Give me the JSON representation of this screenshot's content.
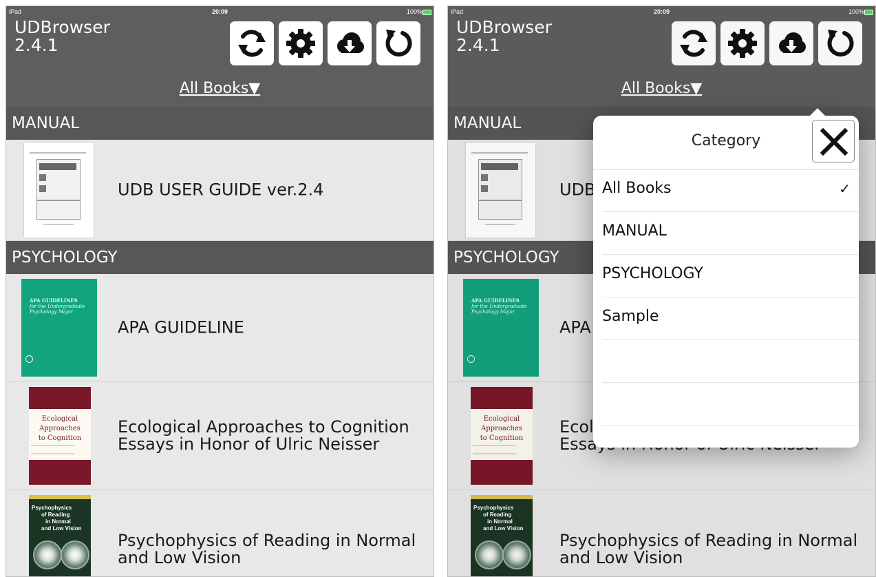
{
  "status_bar": {
    "carrier": "iPad",
    "time": "20:09",
    "battery": "100%"
  },
  "app": {
    "title": "UDBrowser\n2.4.1"
  },
  "toolbar": {
    "buttons": [
      {
        "icon": "sync-icon",
        "name": "sync-button"
      },
      {
        "icon": "gear-icon",
        "name": "settings-button"
      },
      {
        "icon": "cloud-download-icon",
        "name": "download-button"
      },
      {
        "icon": "refresh-icon",
        "name": "refresh-button"
      }
    ]
  },
  "category_selector": {
    "label": "All Books▼"
  },
  "sections": [
    {
      "header": "MANUAL",
      "books": [
        {
          "title": "UDB USER GUIDE ver.2.4",
          "cover": "manual"
        }
      ]
    },
    {
      "header": "PSYCHOLOGY",
      "books": [
        {
          "title": "APA GUIDELINE",
          "cover": "apa",
          "cover_text": [
            "APA GUIDELINES",
            "for the Undergraduate",
            "Psychology Major"
          ]
        },
        {
          "title": "Ecological Approaches to Cognition Essays in Honor of Ulric Neisser",
          "cover": "eco",
          "cover_text": [
            "Ecological",
            "Approaches",
            "to Cognition"
          ]
        },
        {
          "title": "Psychophysics of Reading in Normal and Low Vision",
          "cover": "psy",
          "cover_text": [
            "Psychophysics",
            "of Reading",
            "in Normal",
            "and Low Vision"
          ]
        }
      ]
    }
  ],
  "category_popover": {
    "title": "Category",
    "close_icon": "close-icon",
    "items": [
      {
        "label": "All Books",
        "selected": true,
        "check": "✓"
      },
      {
        "label": "MANUAL",
        "selected": false,
        "check": ""
      },
      {
        "label": "PSYCHOLOGY",
        "selected": false,
        "check": ""
      },
      {
        "label": "Sample",
        "selected": false,
        "check": ""
      },
      {
        "label": "",
        "selected": false,
        "check": ""
      },
      {
        "label": "",
        "selected": false,
        "check": ""
      }
    ]
  },
  "colors": {
    "topbar": "#5e5e5e",
    "section_header": "#575757",
    "list_background": "#e8e8e8",
    "apa_cover": "#12a47c",
    "eco_cover": "#7a1729",
    "psy_cover": "#1b3524"
  }
}
